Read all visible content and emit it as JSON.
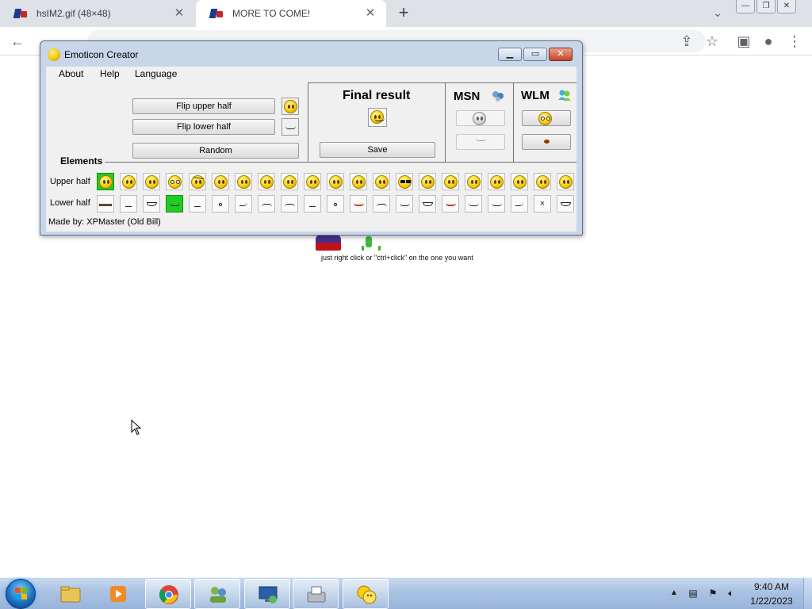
{
  "browser": {
    "tabs": [
      {
        "title": "hsIM2.gif (48×48)",
        "active": false
      },
      {
        "title": "MORE TO COME!",
        "active": true
      }
    ],
    "new_tab_label": "+"
  },
  "page": {
    "hint_text": "just right click or \"ctrl+click\" on the one you want"
  },
  "app": {
    "title": "Emoticon Creator",
    "menu": [
      "About",
      "Help",
      "Language"
    ],
    "buttons": {
      "flip_upper": "Flip upper half",
      "flip_lower": "Flip lower half",
      "random": "Random",
      "save": "Save"
    },
    "final_result_label": "Final result",
    "msn_label": "MSN",
    "wlm_label": "WLM",
    "elements_label": "Elements",
    "upper_half_label": "Upper half",
    "lower_half_label": "Lower half",
    "upper_half_items": [
      "selected",
      "normal",
      "normal",
      "glasses",
      "angry",
      "normal",
      "normal",
      "normal",
      "normal",
      "normal",
      "normal",
      "normal",
      "normal",
      "shades",
      "normal",
      "normal",
      "normal",
      "normal",
      "normal",
      "normal",
      "normal"
    ],
    "lower_half_items": [
      "cig",
      "flat",
      "teeth",
      "smile",
      "flat",
      "dot",
      "wave",
      "frown",
      "frown",
      "flat",
      "dot",
      "tongue",
      "frown",
      "smile",
      "teeth",
      "tongue",
      "smile",
      "smile",
      "wave",
      "x",
      "teeth"
    ],
    "selected_upper_index": 0,
    "selected_lower_index": 3,
    "status_text": "Made by: XPMaster (Old Bill)"
  },
  "taskbar": {
    "items": [
      "explorer",
      "media-player",
      "chrome",
      "network-users",
      "remote-desktop",
      "fax",
      "emoticon-creator"
    ],
    "clock_time": "9:40 AM",
    "clock_date": "1/22/2023"
  },
  "colors": {
    "selected_cell": "#22cc22",
    "face_yellow": "#f6cf10",
    "window_frame": "#c7d6e8"
  }
}
